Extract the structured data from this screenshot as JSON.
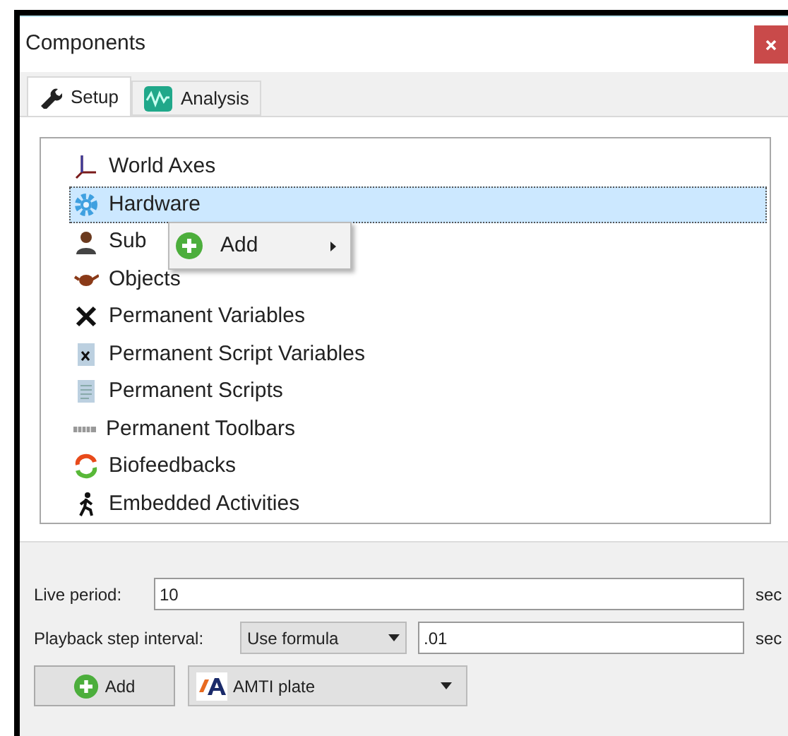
{
  "window": {
    "title": "Components"
  },
  "tabs": [
    {
      "label": "Setup",
      "kind": "wrench",
      "selected": true
    },
    {
      "label": "Analysis",
      "kind": "wave",
      "selected": false
    }
  ],
  "tree": {
    "items": [
      {
        "label": "World Axes",
        "kind": "axes",
        "selected": false
      },
      {
        "label": "Hardware",
        "kind": "gear",
        "selected": true
      },
      {
        "label": "Sub",
        "kind": "person",
        "selected": false
      },
      {
        "label": "Objects",
        "kind": "teapot",
        "selected": false
      },
      {
        "label": "Permanent Variables",
        "kind": "variable",
        "selected": false
      },
      {
        "label": "Permanent Script Variables",
        "kind": "scriptvar",
        "selected": false
      },
      {
        "label": "Permanent Scripts",
        "kind": "script",
        "selected": false
      },
      {
        "label": "Permanent Toolbars",
        "kind": "toolbar",
        "selected": false
      },
      {
        "label": "Biofeedbacks",
        "kind": "cycle",
        "selected": false
      },
      {
        "label": "Embedded Activities",
        "kind": "walker",
        "selected": false
      }
    ]
  },
  "context_menu": {
    "items": [
      {
        "label": "Add",
        "submenu": true
      }
    ]
  },
  "live_period": {
    "label": "Live period:",
    "value": "10",
    "unit": "sec"
  },
  "playback": {
    "label": "Playback step interval:",
    "mode": "Use formula",
    "value": ".01",
    "unit": "sec"
  },
  "add_button": {
    "label": "Add"
  },
  "device_select": {
    "value": "AMTI plate"
  }
}
